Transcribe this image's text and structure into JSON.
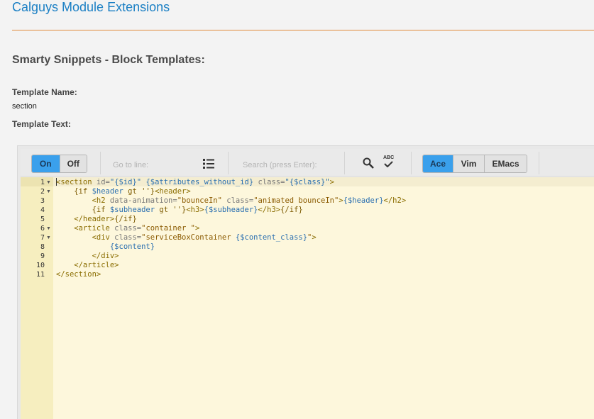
{
  "page": {
    "site_title": "Calguys Module Extensions",
    "section_title": "Smarty Snippets - Block Templates:",
    "template_name_label": "Template Name:",
    "template_name_value": "section",
    "template_text_label": "Template Text:"
  },
  "toolbar": {
    "on_label": "On",
    "off_label": "Off",
    "goto_placeholder": "Go to line:",
    "search_placeholder": "Search (press Enter):",
    "ace_label": "Ace",
    "vim_label": "Vim",
    "emacs_label": "EMacs",
    "spellcheck_text": "ABC"
  },
  "editor": {
    "lines": [
      {
        "n": "1",
        "fold": true
      },
      {
        "n": "2",
        "fold": true
      },
      {
        "n": "3",
        "fold": false
      },
      {
        "n": "4",
        "fold": false
      },
      {
        "n": "5",
        "fold": false
      },
      {
        "n": "6",
        "fold": true
      },
      {
        "n": "7",
        "fold": true
      },
      {
        "n": "8",
        "fold": false
      },
      {
        "n": "9",
        "fold": false
      },
      {
        "n": "10",
        "fold": false
      },
      {
        "n": "11",
        "fold": false
      }
    ],
    "code": {
      "l1": {
        "a": "<section",
        "b": " id=",
        "c": "\"{$id}\"",
        "d": " {$attributes_without_id}",
        "e": " class=",
        "f": "\"{$class}\"",
        "g": ">"
      },
      "l2": {
        "a": "    {if ",
        "b": "$header",
        "c": " gt ''}",
        "d": "<header>"
      },
      "l3": {
        "a": "        <h2",
        "b": " data-animation=",
        "c": "\"bounceIn\"",
        "d": " class=",
        "e": "\"animated bounceIn\"",
        "f": ">",
        "g": "{$header}",
        "h": "</h2>"
      },
      "l4": {
        "a": "        {if ",
        "b": "$subheader",
        "c": " gt ''}",
        "d": "<h3>",
        "e": "{$subheader}",
        "f": "</h3>",
        "g": "{/if}"
      },
      "l5": {
        "a": "    </header>",
        "b": "{/if}"
      },
      "l6": {
        "a": "    <article",
        "b": " class=",
        "c": "\"container \"",
        "d": ">"
      },
      "l7": {
        "a": "        <div",
        "b": " class=",
        "c": "\"serviceBoxContainer ",
        "d": "{$content_class}",
        "e": "\"",
        "f": ">"
      },
      "l8": {
        "a": "            ",
        "b": "{$content}"
      },
      "l9": {
        "a": "        </div>"
      },
      "l10": {
        "a": "    </article>"
      },
      "l11": {
        "a": "</section>"
      }
    }
  },
  "colors": {
    "accent": "#3aa0ec",
    "link": "#1a7fc4",
    "divider": "#e08a3c"
  }
}
